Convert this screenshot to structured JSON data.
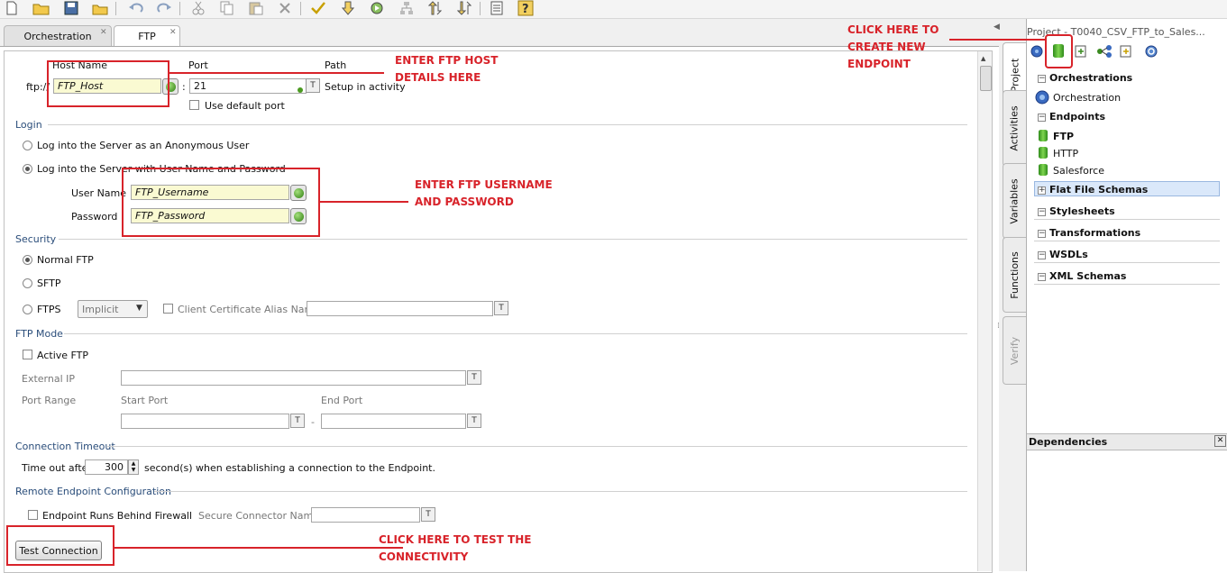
{
  "tabs": [
    {
      "label": "Orchestration",
      "active": false
    },
    {
      "label": "FTP",
      "active": true
    }
  ],
  "form": {
    "host_header": "Host Name",
    "port_header": "Port",
    "path_header": "Path",
    "scheme": "ftp://",
    "host_value": "FTP_Host",
    "colon": ":",
    "port_value": "21",
    "path_value": "Setup in activity",
    "use_default_port": "Use default port",
    "login": {
      "title": "Login",
      "anonymous": "Log into the Server as an Anonymous User",
      "named": "Log into the Server with User Name and Password",
      "username_label": "User Name",
      "username_value": "FTP_Username",
      "password_label": "Password",
      "password_value": "FTP_Password",
      "selected": "named"
    },
    "security": {
      "title": "Security",
      "normal": "Normal FTP",
      "sftp": "SFTP",
      "ftps": "FTPS",
      "ftps_mode": "Implicit",
      "client_cert": "Client Certificate Alias Name",
      "selected": "normal"
    },
    "ftp_mode": {
      "title": "FTP Mode",
      "active_ftp": "Active FTP",
      "external_ip": "External IP",
      "port_range": "Port Range",
      "start_port": "Start Port",
      "end_port": "End Port",
      "dash": "-"
    },
    "timeout": {
      "title": "Connection Timeout",
      "prefix": "Time out after",
      "value": "300",
      "suffix": "second(s) when establishing a connection to the Endpoint."
    },
    "remote": {
      "title": "Remote Endpoint Configuration",
      "firewall": "Endpoint Runs Behind Firewall",
      "secure_connector": "Secure Connector Name"
    },
    "test_button": "Test Connection"
  },
  "annotations": {
    "host": [
      "ENTER FTP HOST",
      "DETAILS HERE"
    ],
    "credentials": [
      "ENTER FTP USERNAME",
      "AND PASSWORD"
    ],
    "new_endpoint": [
      "CLICK HERE TO",
      "CREATE NEW",
      "ENDPOINT"
    ],
    "test": [
      "CLICK HERE TO TEST THE",
      "CONNECTIVITY"
    ],
    "color": "#d8232a"
  },
  "side_tabs": [
    "Project",
    "Activities",
    "Variables",
    "Functions",
    "Verify"
  ],
  "project": {
    "title": "Project - T0040_CSV_FTP_to_Sales...",
    "tree": {
      "orchestrations": "Orchestrations",
      "orchestration_item": "Orchestration",
      "endpoints": "Endpoints",
      "endpoint_items": [
        "FTP",
        "HTTP",
        "Salesforce"
      ],
      "flat_file": "Flat File Schemas",
      "stylesheets": "Stylesheets",
      "transformations": "Transformations",
      "wsdls": "WSDLs",
      "xml_schemas": "XML Schemas"
    },
    "dependencies": "Dependencies"
  }
}
